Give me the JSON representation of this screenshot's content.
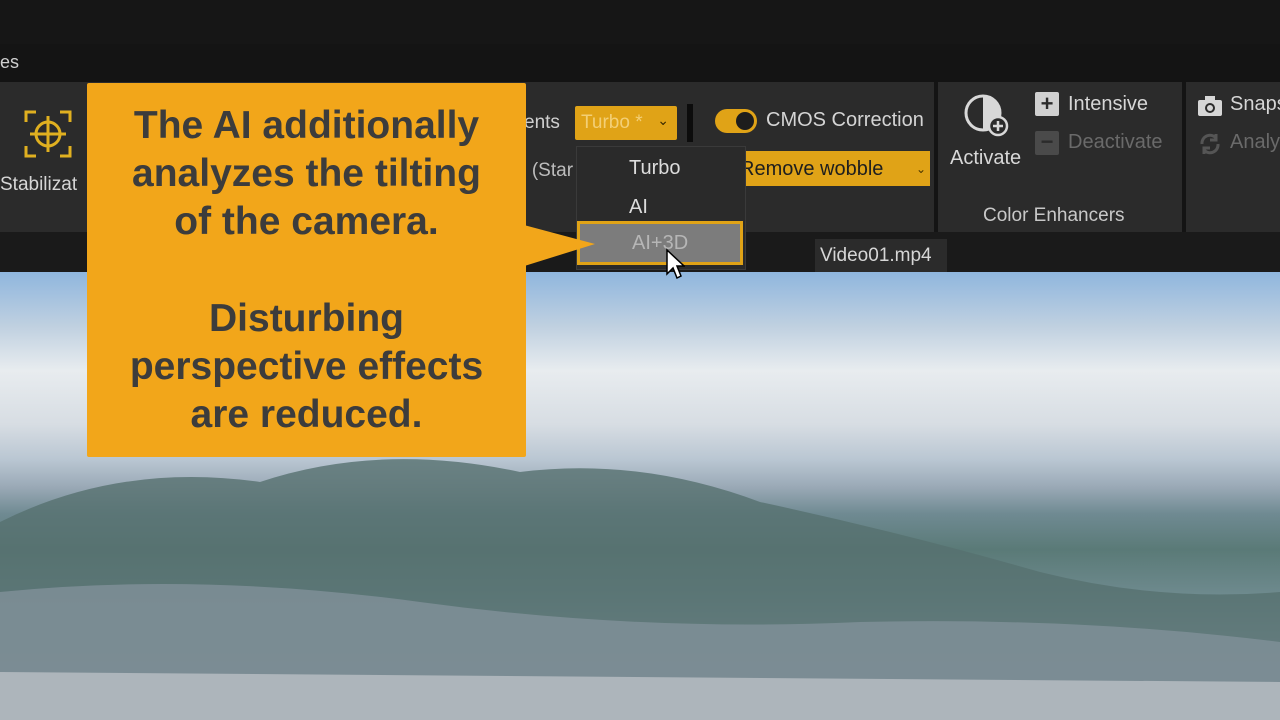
{
  "menubar": {
    "partial_label": "es"
  },
  "stabilization": {
    "label": "Stabilizat"
  },
  "movements": {
    "partial_label": "ents"
  },
  "mode_select": {
    "value": "Turbo *"
  },
  "preset": {
    "partial_label": "e (Star"
  },
  "cmos": {
    "label": "CMOS Correction",
    "mode": "Remove wobble",
    "enabled": true
  },
  "dropdown": {
    "items": [
      "Turbo",
      "AI",
      "AI+3D"
    ],
    "highlighted_index": 2
  },
  "color_enhancers": {
    "activate_label": "Activate",
    "intensive_label": "Intensive",
    "deactivate_label": "Deactivate",
    "group_label": "Color Enhancers"
  },
  "snapshot": {
    "snap_label": "Snaps",
    "analyze_label": "Analy"
  },
  "file_tab": {
    "name": "Video01.mp4"
  },
  "callout": {
    "lines_1": [
      "The AI additionally",
      "analyzes the tilting",
      "of the camera."
    ],
    "lines_2": [
      "Disturbing",
      "perspective effects",
      "are reduced."
    ]
  },
  "colors": {
    "accent": "#E0A317",
    "callout_bg": "#F2A61A",
    "ribbon_bg": "#2B2B2B"
  },
  "icons": [
    "stabilization-target-icon",
    "toggle-switch-icon",
    "activate-color-icon",
    "plus-icon",
    "minus-icon",
    "camera-icon",
    "analyze-icon",
    "mouse-cursor-icon"
  ]
}
